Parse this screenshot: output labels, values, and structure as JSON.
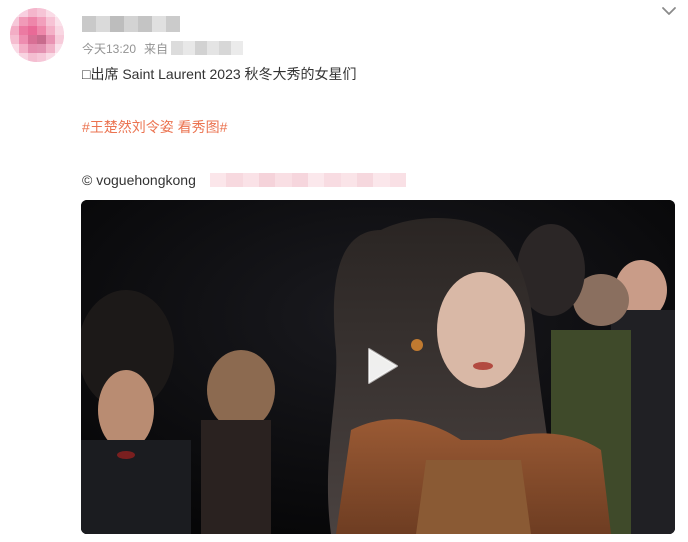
{
  "post": {
    "time": "今天13:20",
    "from_label": "来自",
    "text_line1": "□出席 Saint Laurent 2023 秋冬大秀的女星们",
    "hashtag": "#王楚然刘令姿 看秀图#",
    "credit": "© voguehongkong"
  },
  "icons": {
    "collapse": "chevron-down-icon",
    "play": "play-icon"
  },
  "colors": {
    "hashtag": "#eb7350",
    "meta_text": "#939393",
    "body_text": "#333333",
    "avatar_pink": "#f7c6d9"
  }
}
